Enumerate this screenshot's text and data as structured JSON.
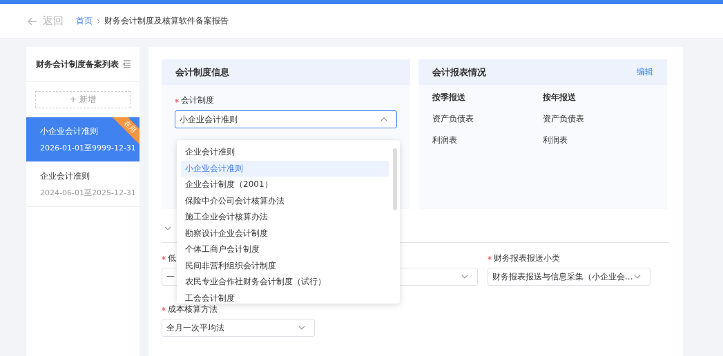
{
  "header": {
    "back": "返回",
    "breadcrumb": [
      {
        "label": "首页",
        "link": true
      },
      {
        "label": "财务会计制度及核算软件备案报告",
        "link": false
      }
    ]
  },
  "sidebar": {
    "title": "财务会计制度备案列表",
    "add_button": "+ 新增",
    "items": [
      {
        "name": "小企业会计准则",
        "period": "2026-01-01至9999-12-31",
        "selected": true,
        "badge": "在用"
      },
      {
        "name": "企业会计准则",
        "period": "2024-06-01至2025-12-31",
        "selected": false
      }
    ]
  },
  "system_card": {
    "title": "会计制度信息",
    "field": {
      "label": "会计制度",
      "required": true,
      "value": "小企业会计准则",
      "expanded": true
    }
  },
  "report_card": {
    "title": "会计报表情况",
    "edit_link": "编辑",
    "columns": [
      {
        "heading": "按季报送",
        "items": [
          "资产负债表",
          "利润表"
        ]
      },
      {
        "heading": "按年报送",
        "items": [
          "资产负债表",
          "利润表"
        ]
      }
    ]
  },
  "dropdown": {
    "options": [
      {
        "label": "企业会计准则",
        "selected": false
      },
      {
        "label": "小企业会计准则",
        "selected": true
      },
      {
        "label": "企业会计制度（2001）",
        "selected": false
      },
      {
        "label": "保险中介公司会计核算办法",
        "selected": false
      },
      {
        "label": "施工企业会计核算办法",
        "selected": false
      },
      {
        "label": "勘察设计企业会计制度",
        "selected": false
      },
      {
        "label": "个体工商户会计制度",
        "selected": false
      },
      {
        "label": "民间非营利组织会计制度",
        "selected": false
      },
      {
        "label": "农民专业合作社财务会计制度（试行）",
        "selected": false
      },
      {
        "label": "工会会计制度",
        "selected": false
      }
    ]
  },
  "form_rows": [
    {
      "fields": [
        {
          "kind": "select",
          "label": "低",
          "required": true,
          "value": "一",
          "chevron": false
        },
        {
          "kind": "select"
        },
        {
          "kind": "select",
          "label": "财务报表报送小类",
          "required": true,
          "value": "财务报表报送与信息采集（小企业会..."
        }
      ]
    },
    {
      "fields": [
        {
          "kind": "select",
          "label": "成本核算方法",
          "required": true,
          "value": "全月一次平均法"
        }
      ]
    }
  ]
}
